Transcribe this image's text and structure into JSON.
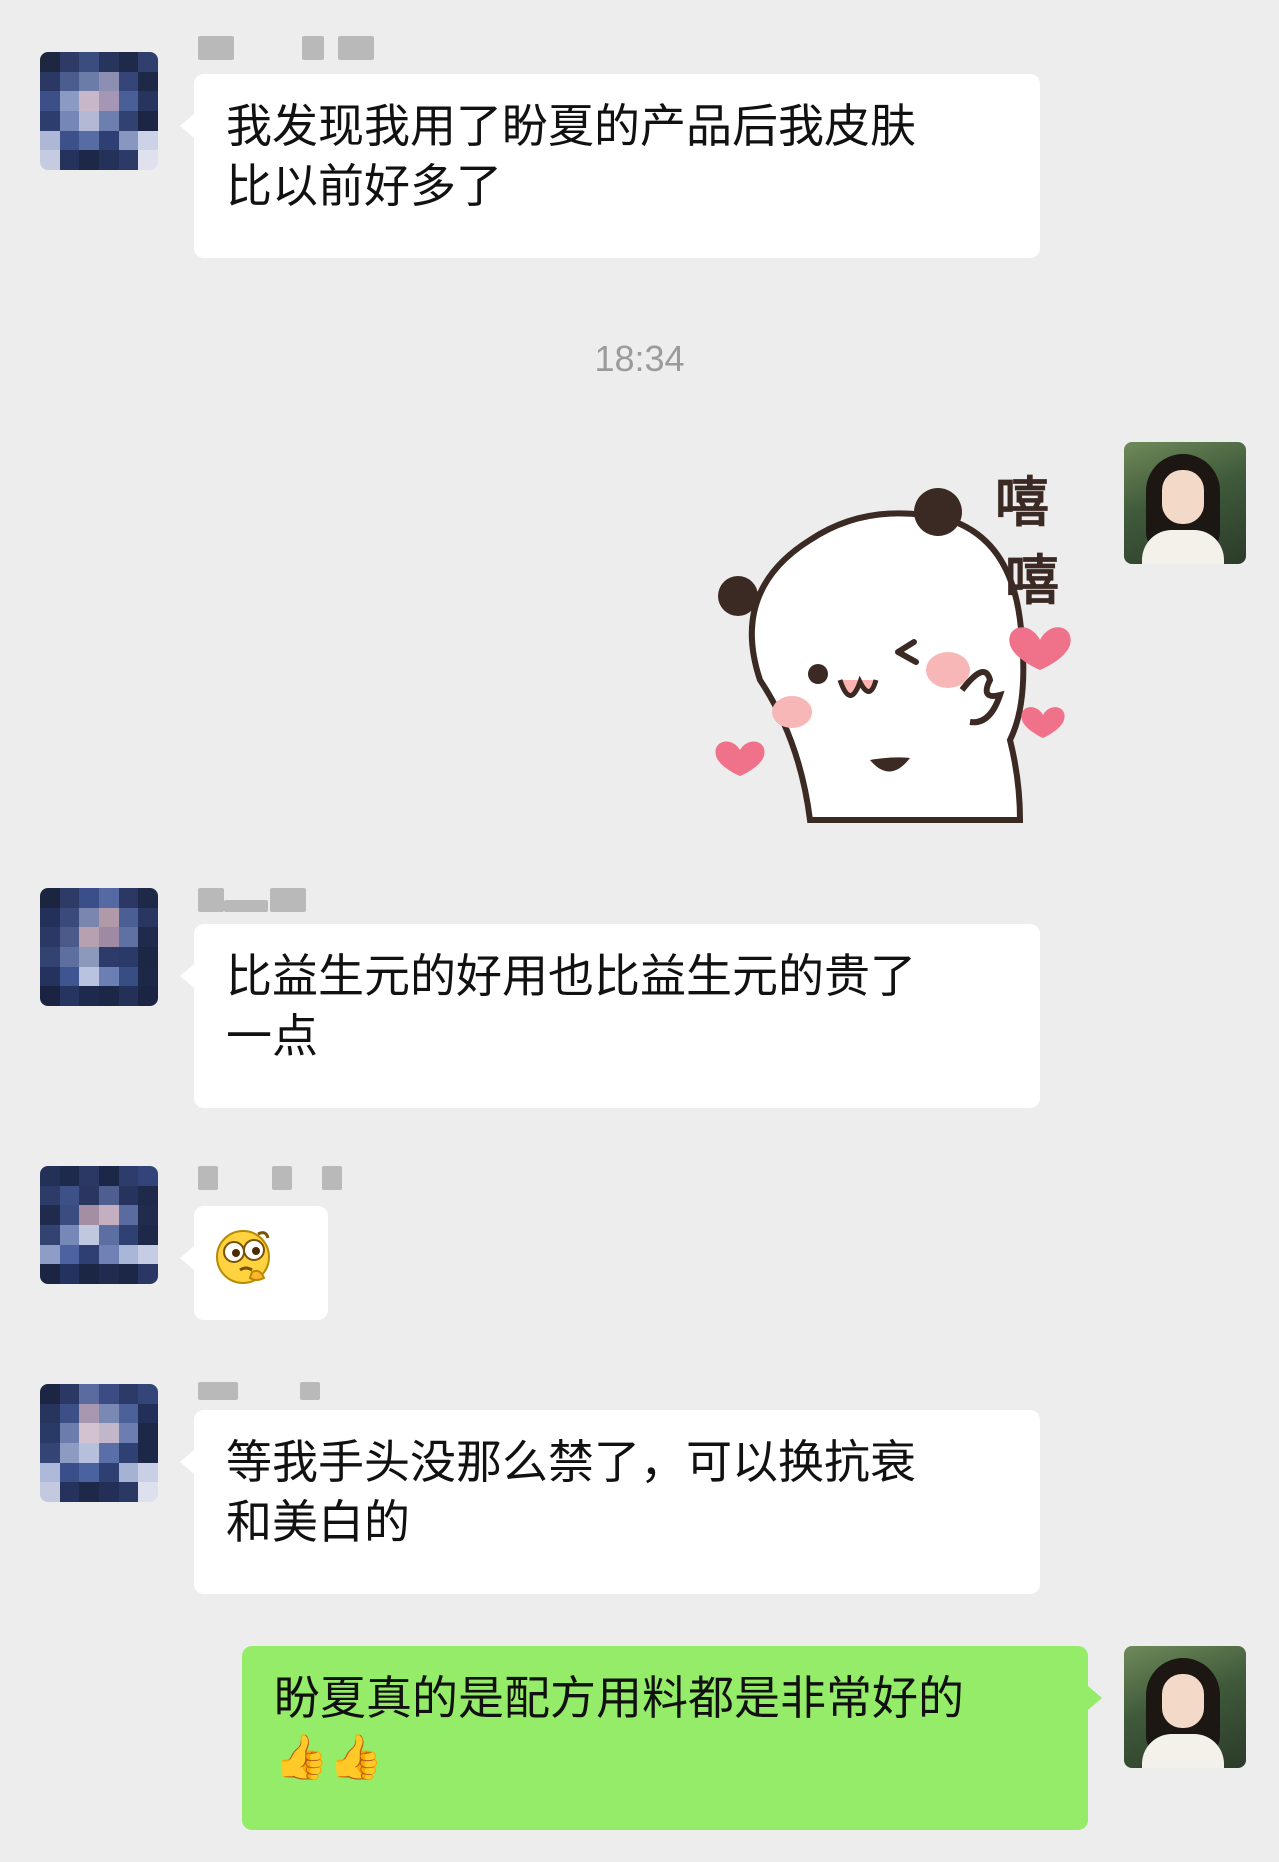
{
  "colors": {
    "background": "#ededed",
    "incoming_bubble": "#ffffff",
    "outgoing_bubble": "#95ec69",
    "timestamp_text": "#9b9b9b"
  },
  "timestamp": "18:34",
  "messages": [
    {
      "side": "left",
      "lines": [
        "我发现我用了盼夏的产品后我皮肤",
        "比以前好多了"
      ]
    },
    {
      "side": "right",
      "type": "sticker",
      "sticker_text": [
        "嘻",
        "嘻"
      ],
      "sticker_icon": "panda-sticker"
    },
    {
      "side": "left",
      "lines": [
        "比益生元的好用也比益生元的贵了",
        "一点"
      ]
    },
    {
      "side": "left",
      "type": "emoji",
      "emoji_icon": "thinking-face-emoji"
    },
    {
      "side": "left",
      "lines": [
        "等我手头没那么禁了，可以换抗衰",
        "和美白的"
      ]
    },
    {
      "side": "right",
      "lines": [
        "盼夏真的是配方用料都是非常好的",
        "👍👍"
      ]
    }
  ]
}
